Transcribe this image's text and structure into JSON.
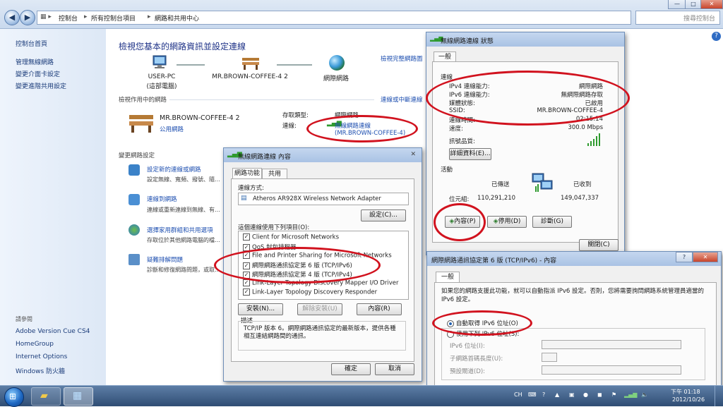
{
  "address_bar": {
    "crumbs": [
      "控制台",
      "所有控制台項目",
      "網路和共用中心"
    ],
    "search_placeholder": "搜尋控制台"
  },
  "window_controls": {
    "minimize": "—",
    "maximize": "□",
    "close": "✕"
  },
  "sidebar": {
    "home": "控制台首頁",
    "items": [
      "管理無線網路",
      "變更介面卡設定",
      "變更進階共用設定"
    ],
    "see_also_title": "請參閱",
    "see_also": [
      "Adobe Version Cue CS4",
      "HomeGroup",
      "Internet Options",
      "Windows 防火牆"
    ]
  },
  "main": {
    "title": "檢視您基本的網路資訊並設定連線",
    "full_map_link": "檢視完整網路圖",
    "map": {
      "pc_name": "USER-PC",
      "pc_sub": "(這部電腦)",
      "network_name": "MR.BROWN-COFFEE-4 2",
      "internet": "網際網路"
    },
    "active_title": "檢視作用中的網路",
    "connect_link": "連線或中斷連線",
    "active": {
      "name": "MR.BROWN-COFFEE-4 2",
      "type": "公用網路",
      "access_label": "存取類型:",
      "access_value": "網際網路",
      "conn_label": "連線:",
      "conn_value": "無線網路連線",
      "conn_ssid": "(MR.BROWN-COFFEE-4)"
    },
    "change_title": "變更網路設定",
    "tasks": [
      {
        "title": "設定新的連線或網路",
        "desc": "設定無線、寬頻、撥號、隨…"
      },
      {
        "title": "連線到網路",
        "desc": "連線或重新連線到無線、有…"
      },
      {
        "title": "選擇家用群組和共用選項",
        "desc": "存取位於其他網路電腦的檔…"
      },
      {
        "title": "疑難排解問題",
        "desc": "診斷和修復網路問題，或取…"
      }
    ]
  },
  "status_dialog": {
    "title": "無線網路連線 狀態",
    "tab": "一般",
    "conn_group": "連線",
    "rows": [
      {
        "label": "IPv4 連線能力:",
        "value": "網際網路"
      },
      {
        "label": "IPv6 連線能力:",
        "value": "無網際網路存取"
      },
      {
        "label": "媒體狀態:",
        "value": "已啟用"
      },
      {
        "label": "SSID:",
        "value": "MR.BROWN-COFFEE-4"
      },
      {
        "label": "連線時間:",
        "value": "02:15:14"
      },
      {
        "label": "速度:",
        "value": "300.0 Mbps"
      }
    ],
    "signal_label": "訊號品質:",
    "signal_level": 5,
    "details_btn": "詳細資料(E)...",
    "activity_group": "活動",
    "sent_label": "已傳送",
    "received_label": "已收到",
    "bytes_label": "位元組:",
    "bytes_sent": "110,291,210",
    "bytes_received": "149,047,337",
    "props_btn": "內容(P)",
    "disable_btn": "停用(D)",
    "diagnose_btn": "診斷(G)",
    "close_btn": "關閉(C)"
  },
  "props_dialog": {
    "title": "無線網路連線 內容",
    "tabs": [
      "網路功能",
      "共用"
    ],
    "connect_using": "連線方式:",
    "adapter": "Atheros AR928X Wireless Network Adapter",
    "config_btn": "設定(C)...",
    "items_label": "這個連線使用下列項目(O):",
    "items": [
      "Client for Microsoft Networks",
      "QoS 封包排程器",
      "File and Printer Sharing for Microsoft Networks",
      "網際網路通訊協定第 6 版 (TCP/IPv6)",
      "網際網路通訊協定第 4 版 (TCP/IPv4)",
      "Link-Layer Topology Discovery Mapper I/O Driver",
      "Link-Layer Topology Discovery Responder"
    ],
    "install_btn": "安裝(N)...",
    "uninstall_btn": "解除安裝(U)",
    "properties_btn": "內容(R)",
    "desc_label": "描述",
    "desc_text": "TCP/IP 版本 6。網際網路通訊協定的最新版本，提供各種相互連結網路間的通訊。",
    "ok_btn": "確定",
    "cancel_btn": "取消"
  },
  "ipv6_dialog": {
    "title": "網際網路通訊協定第 6 版 (TCP/IPv6) - 內容",
    "help": "?",
    "tab": "一般",
    "intro": "如果您的網路支援此功能，就可以自動指派 IPv6 設定。否則，您將需要詢問網路系統管理員適當的 IPv6 設定。",
    "auto_option": "自動取得 IPv6 位址(O)",
    "manual_option": "使用下列 IPv6 位址(S):",
    "fields": [
      "IPv6 位址(I):",
      "子網路首碼長度(U):",
      "預設閘道(D):"
    ]
  },
  "taskbar": {
    "lang": "CH",
    "time": "下午 01:18",
    "date": "2012/10/26"
  }
}
